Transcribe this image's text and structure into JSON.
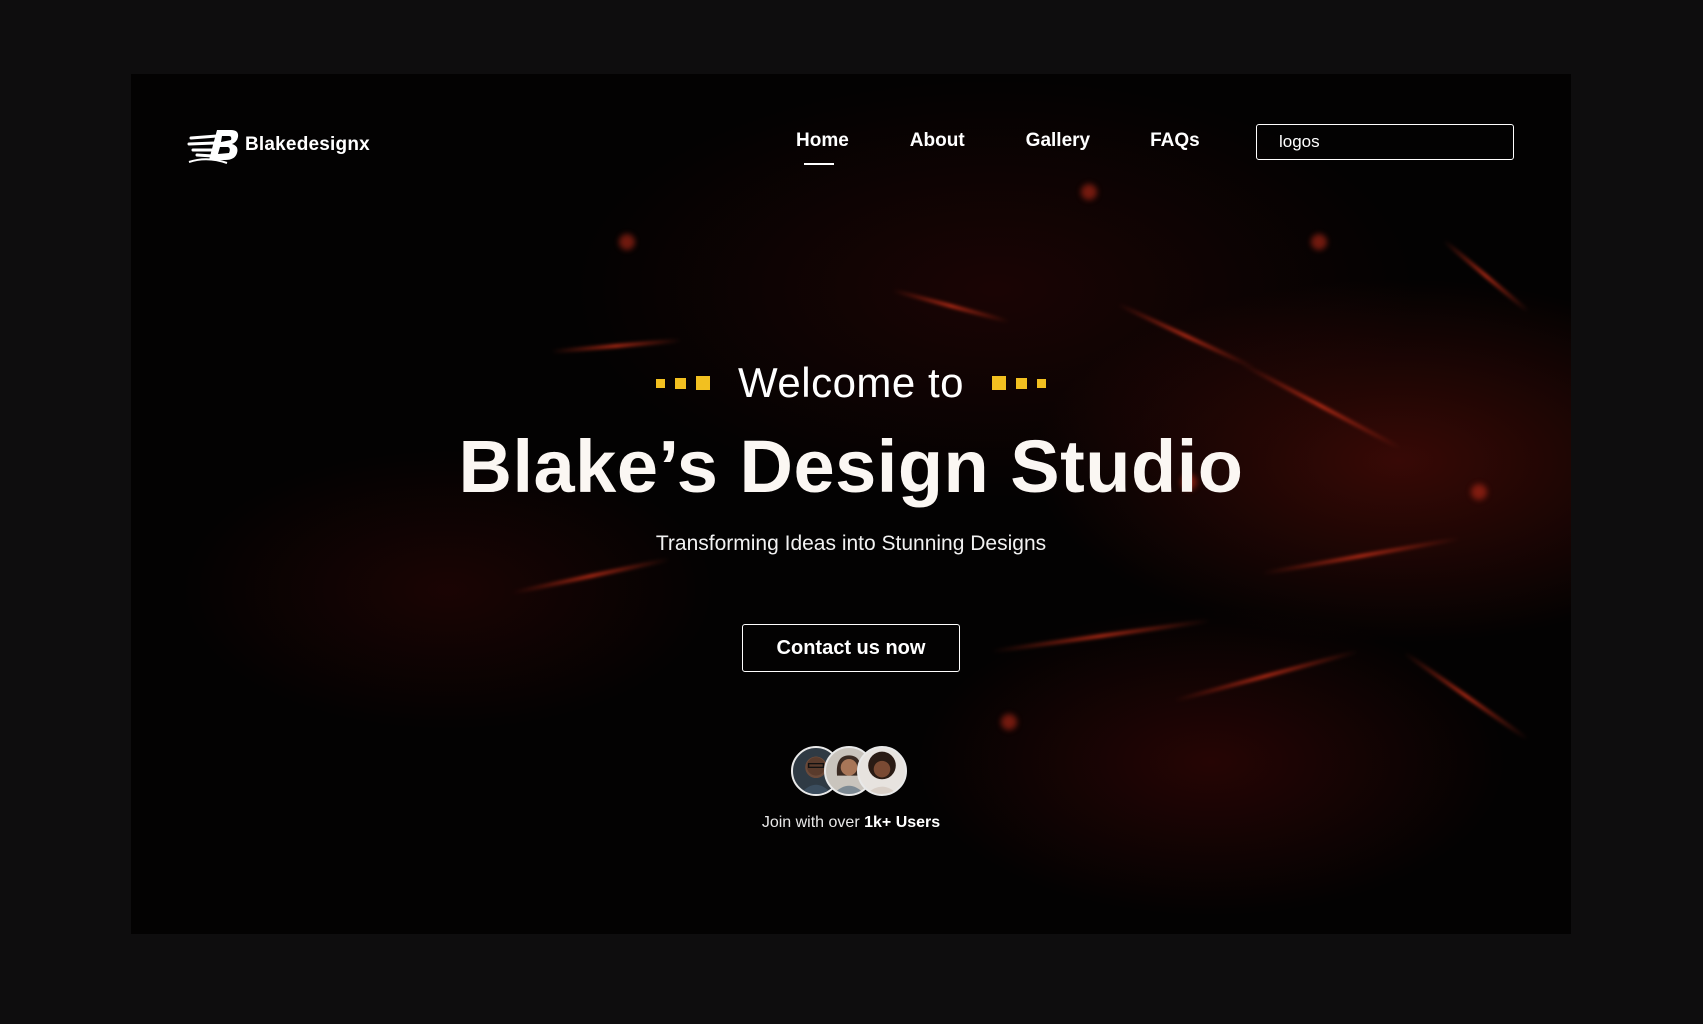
{
  "brand": {
    "name": "Blakedesignx",
    "logo_icon": "stylized-b-logo-icon"
  },
  "nav": {
    "items": [
      {
        "label": "Home",
        "active": true
      },
      {
        "label": "About",
        "active": false
      },
      {
        "label": "Gallery",
        "active": false
      },
      {
        "label": "FAQs",
        "active": false
      }
    ]
  },
  "search": {
    "value": "logos",
    "icon": "search-icon"
  },
  "hero": {
    "welcome": "Welcome to",
    "title": "Blake’s Design Studio",
    "subtitle": "Transforming Ideas into Stunning Designs",
    "cta_label": "Contact us now"
  },
  "social_proof": {
    "prefix": "Join with over",
    "highlight": "1k+ Users",
    "avatars": [
      "avatar-man-glasses",
      "avatar-woman",
      "avatar-woman-curly"
    ]
  },
  "colors": {
    "accent": "#f2c020",
    "background": "#030202",
    "outer_background": "#0e0d0e",
    "text": "#ffffff"
  }
}
